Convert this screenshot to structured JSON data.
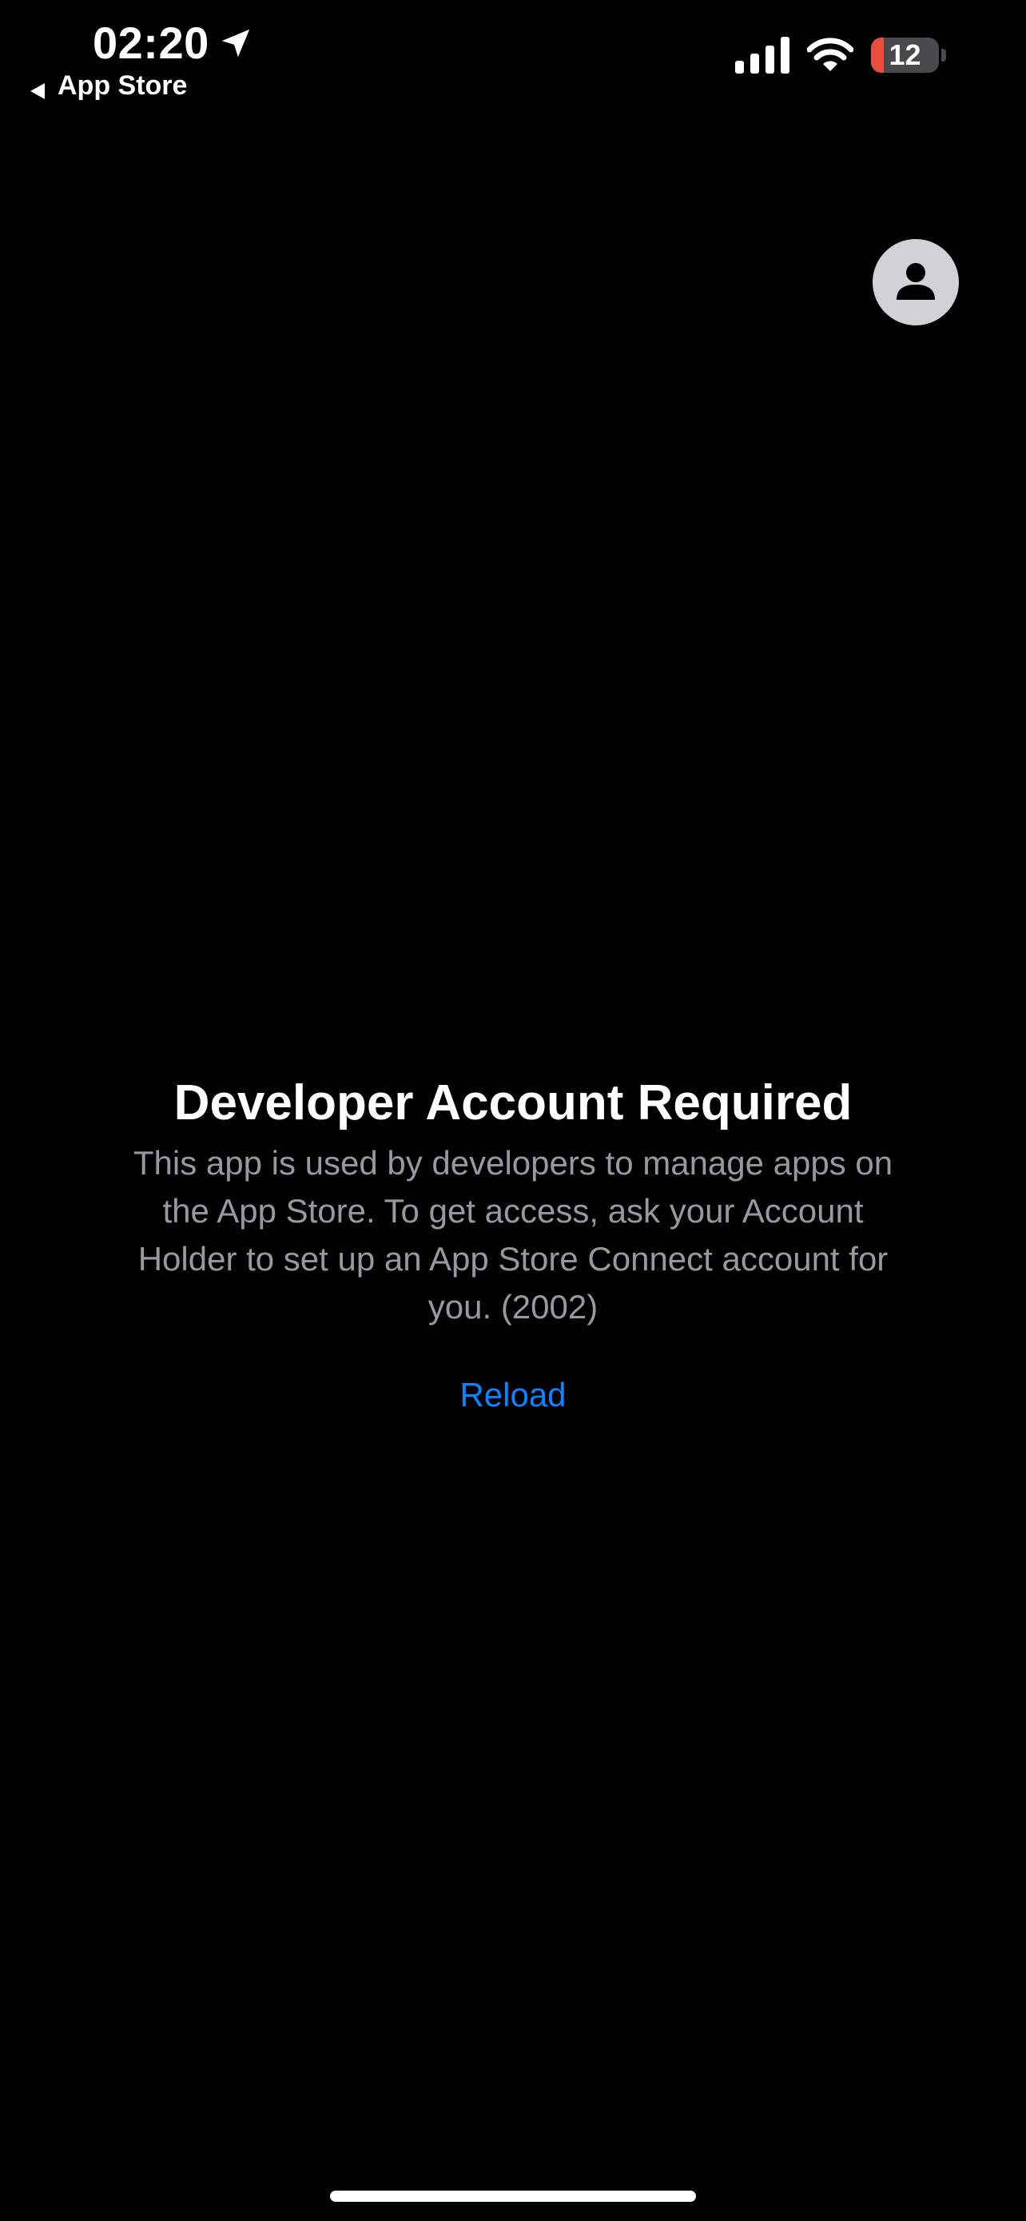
{
  "status_bar": {
    "time": "02:20",
    "back_label": "App Store",
    "battery_level": "12",
    "battery_fraction": 0.12,
    "icons": [
      "location-arrow-icon",
      "cellular-signal-icon",
      "wifi-icon",
      "battery-icon"
    ]
  },
  "header": {
    "account_icon": "person-icon"
  },
  "message": {
    "title": "Developer Account Required",
    "body": "This app is used by developers to manage apps on the App Store. To get access, ask your Account Holder to set up an App Store Connect account for you. (2002)",
    "reload_label": "Reload"
  },
  "colors": {
    "background": "#000000",
    "link": "#0a84ff",
    "secondary_text": "#98989f",
    "battery_low": "#eb4d3d"
  }
}
